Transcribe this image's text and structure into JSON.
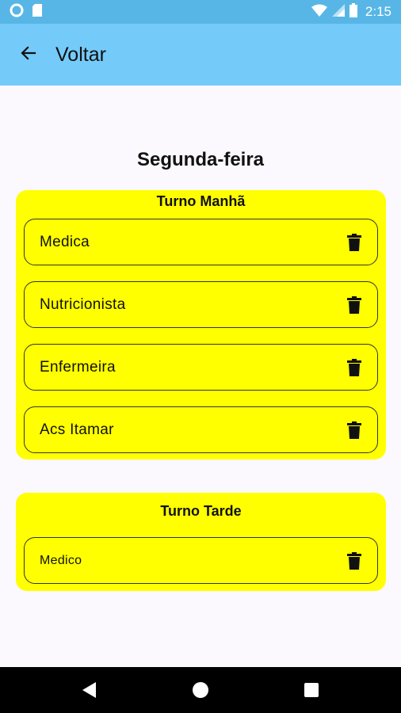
{
  "status_bar": {
    "time": "2:15",
    "icons": [
      "circle-icon",
      "sd-card-icon",
      "wifi-icon",
      "signal-icon",
      "battery-icon"
    ]
  },
  "app_bar": {
    "back_icon": "arrow-left-icon",
    "title": "Voltar",
    "background": "#74cbf9"
  },
  "day": {
    "title": "Segunda-feira"
  },
  "shifts": [
    {
      "title": "Turno Manhã",
      "items": [
        {
          "label": "Medica"
        },
        {
          "label": "Nutricionista"
        },
        {
          "label": "Enfermeira"
        },
        {
          "label": "Acs Itamar"
        }
      ]
    },
    {
      "title": "Turno Tarde",
      "items": [
        {
          "label": "Medico"
        }
      ]
    }
  ],
  "colors": {
    "card": "#ffff00",
    "status_bar": "#58b6e6"
  },
  "nav_bar": {
    "icons": [
      "back-triangle-icon",
      "home-circle-icon",
      "recents-square-icon"
    ]
  }
}
